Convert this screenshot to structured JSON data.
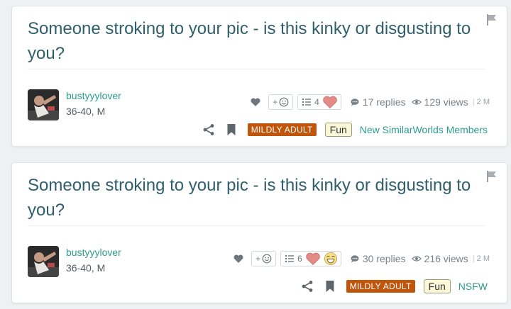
{
  "posts": [
    {
      "title": "Someone stroking to your pic - is this kinky or disgusting to you?",
      "author": "bustyyylover",
      "author_info": "36-40, M",
      "add_reaction_label": "+",
      "reaction_count": "4",
      "reaction_icons": [
        "heart-reaction-icon"
      ],
      "replies": "17 replies",
      "views": "129 views",
      "age": "2 M",
      "maturity_tag": "MILDLY ADULT",
      "category_tag": "Fun",
      "group_link": "New SimilarWorlds Members"
    },
    {
      "title": "Someone stroking to your pic - is this kinky or disgusting to you?",
      "author": "bustyyylover",
      "author_info": "36-40, M",
      "add_reaction_label": "+",
      "reaction_count": "6",
      "reaction_icons": [
        "heart-reaction-icon",
        "laughing-face-reaction-icon"
      ],
      "replies": "30 replies",
      "views": "216 views",
      "age": "2 M",
      "maturity_tag": "MILDLY ADULT",
      "category_tag": "Fun",
      "group_link": "NSFW"
    }
  ],
  "colors": {
    "title": "#2f5f6b",
    "link": "#2b9c8e",
    "mature_tag": "#c0560b",
    "fun_tag_bg": "#fbf7d8",
    "heart_reaction": "#e58b87"
  }
}
